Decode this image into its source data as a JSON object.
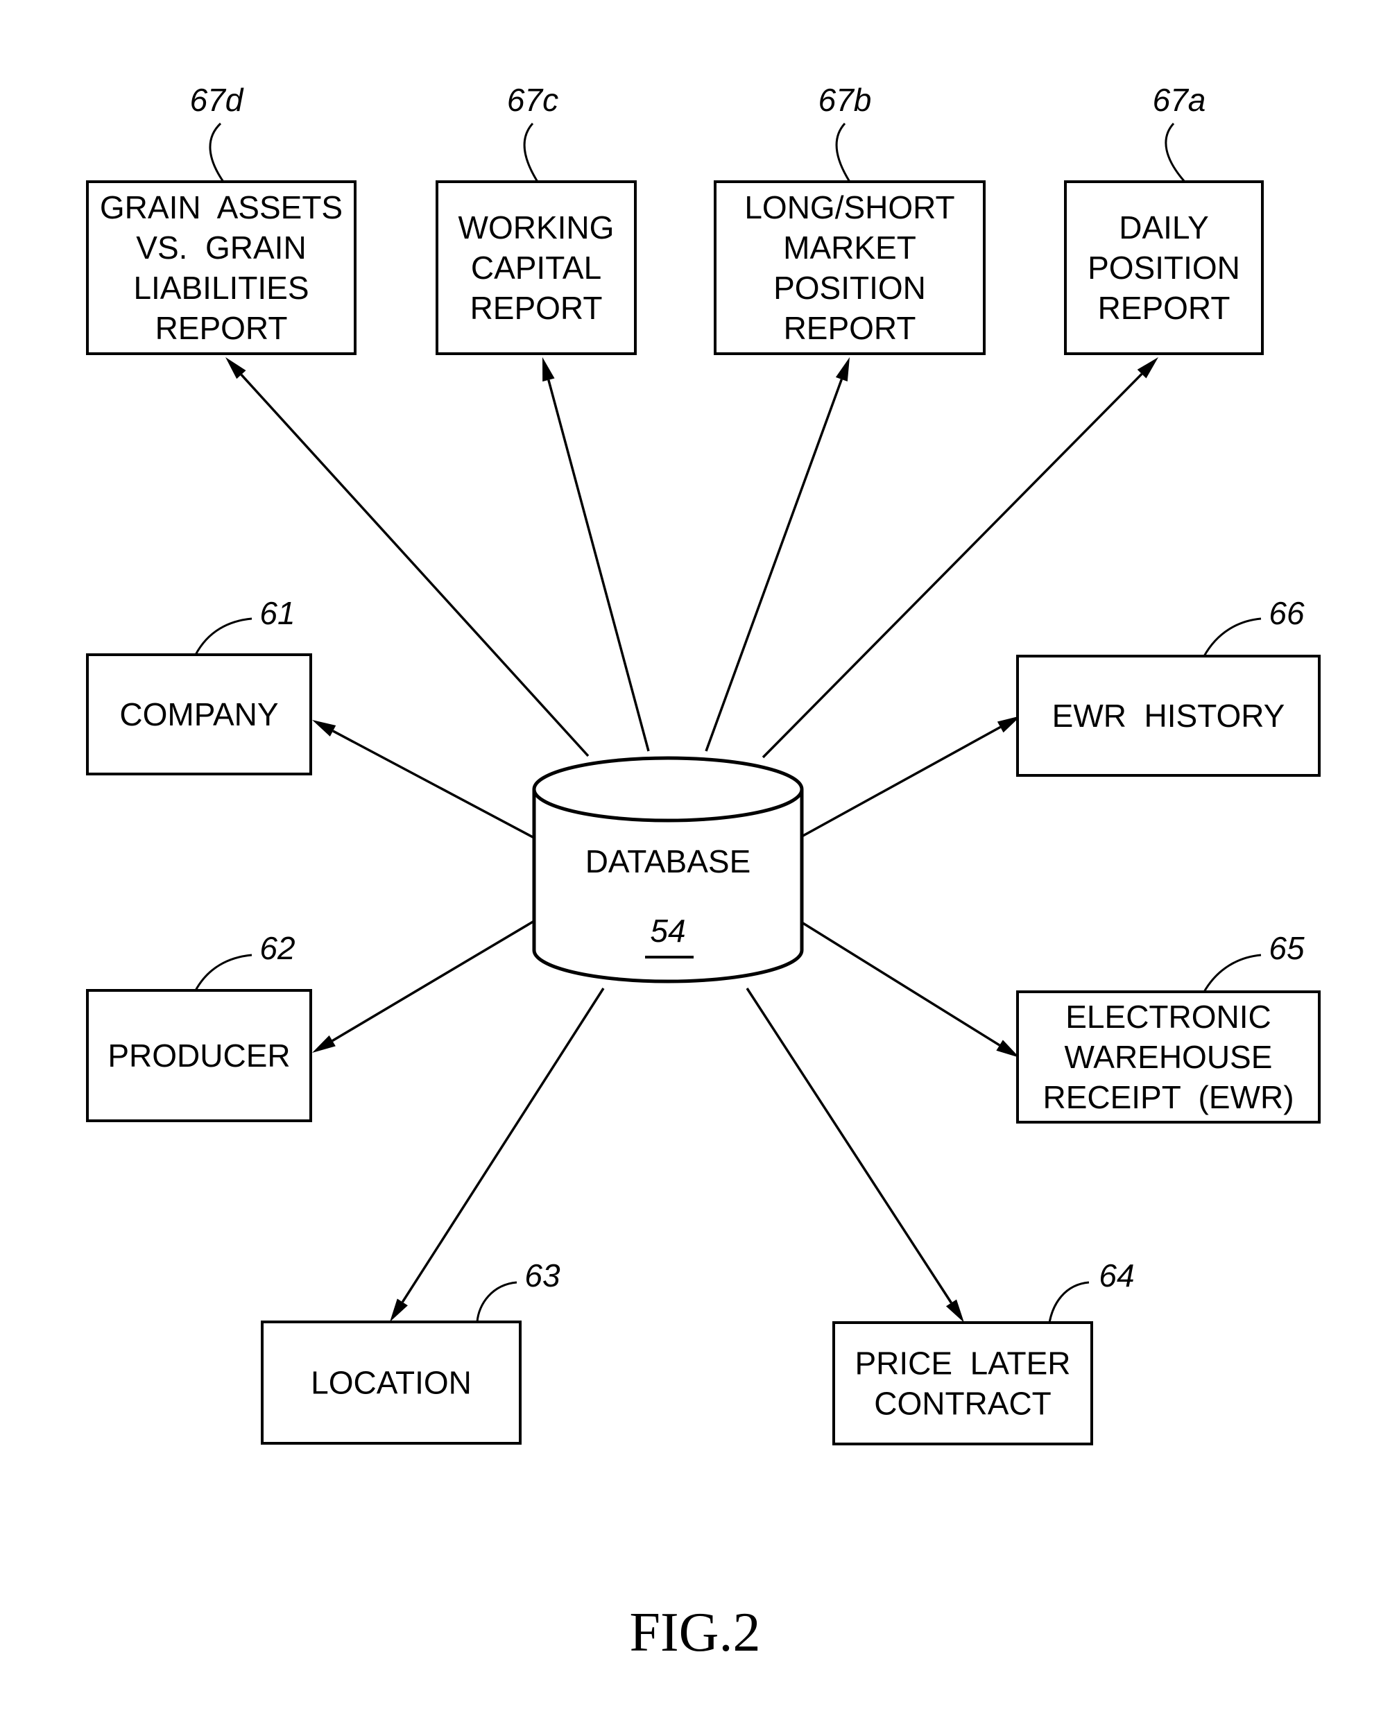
{
  "diagram": {
    "center": {
      "id": "database",
      "label": "DATABASE",
      "ref": "54"
    },
    "nodes": [
      {
        "id": "company",
        "ref": "61",
        "lines": [
          "COMPANY"
        ]
      },
      {
        "id": "producer",
        "ref": "62",
        "lines": [
          "PRODUCER"
        ]
      },
      {
        "id": "location",
        "ref": "63",
        "lines": [
          "LOCATION"
        ]
      },
      {
        "id": "price-later-contract",
        "ref": "64",
        "lines": [
          "PRICE  LATER",
          "CONTRACT"
        ]
      },
      {
        "id": "electronic-warehouse-receipt",
        "ref": "65",
        "lines": [
          "ELECTRONIC",
          "WAREHOUSE",
          "RECEIPT  (EWR)"
        ]
      },
      {
        "id": "ewr-history",
        "ref": "66",
        "lines": [
          "EWR  HISTORY"
        ]
      },
      {
        "id": "daily-position-report",
        "ref": "67a",
        "lines": [
          "DAILY",
          "POSITION",
          "REPORT"
        ]
      },
      {
        "id": "long-short-market-position-report",
        "ref": "67b",
        "lines": [
          "LONG/SHORT",
          "MARKET",
          "POSITION",
          "REPORT"
        ]
      },
      {
        "id": "working-capital-report",
        "ref": "67c",
        "lines": [
          "WORKING",
          "CAPITAL",
          "REPORT"
        ]
      },
      {
        "id": "grain-assets-vs-liabilities-report",
        "ref": "67d",
        "lines": [
          "GRAIN  ASSETS",
          "VS.  GRAIN",
          "LIABILITIES",
          "REPORT"
        ]
      }
    ],
    "edges": [
      {
        "from": "database",
        "to": "grain-assets-vs-liabilities-report"
      },
      {
        "from": "database",
        "to": "working-capital-report"
      },
      {
        "from": "database",
        "to": "long-short-market-position-report"
      },
      {
        "from": "database",
        "to": "daily-position-report"
      },
      {
        "from": "database",
        "to": "company"
      },
      {
        "from": "database",
        "to": "ewr-history"
      },
      {
        "from": "database",
        "to": "producer"
      },
      {
        "from": "database",
        "to": "electronic-warehouse-receipt"
      },
      {
        "from": "database",
        "to": "location"
      },
      {
        "from": "database",
        "to": "price-later-contract"
      }
    ],
    "figure_label": "FIG.2"
  }
}
